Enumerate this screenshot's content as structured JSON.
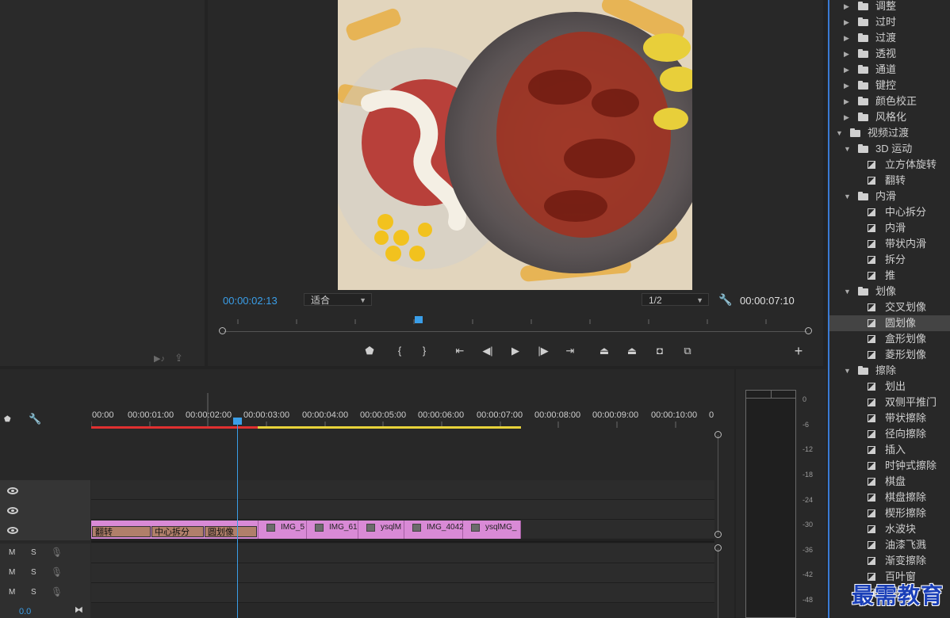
{
  "program": {
    "current_timecode": "00:00:02:13",
    "fit_label": "适合",
    "resolution_label": "1/2",
    "duration_timecode": "00:00:07:10"
  },
  "timeline": {
    "ruler": [
      "00:00",
      "00:00:01:00",
      "00:00:02:00",
      "00:00:03:00",
      "00:00:04:00",
      "00:00:05:00",
      "00:00:06:00",
      "00:00:07:00",
      "00:00:08:00",
      "00:00:09:00",
      "00:00:10:00",
      "0"
    ],
    "transitions": [
      "翻转",
      "中心拆分",
      "圆划像"
    ],
    "clips": [
      "IMG_5",
      "IMG_61",
      "ysqlM",
      "IMG_4042",
      "ysqlMG_"
    ],
    "audio_tracks": [
      {
        "m": "M",
        "s": "S"
      },
      {
        "m": "M",
        "s": "S"
      },
      {
        "m": "M",
        "s": "S"
      }
    ],
    "master_value": "0.0"
  },
  "meter": {
    "labels": [
      "0",
      "-6",
      "-12",
      "-18",
      "-24",
      "-30",
      "-36",
      "-42",
      "-48"
    ]
  },
  "effects": {
    "rows": [
      {
        "label": "调整",
        "type": "folder",
        "level": 1,
        "expanded": false
      },
      {
        "label": "过时",
        "type": "folder",
        "level": 1,
        "expanded": false
      },
      {
        "label": "过渡",
        "type": "folder",
        "level": 1,
        "expanded": false
      },
      {
        "label": "透视",
        "type": "folder",
        "level": 1,
        "expanded": false
      },
      {
        "label": "通道",
        "type": "folder",
        "level": 1,
        "expanded": false
      },
      {
        "label": "键控",
        "type": "folder",
        "level": 1,
        "expanded": false
      },
      {
        "label": "颜色校正",
        "type": "folder",
        "level": 1,
        "expanded": false
      },
      {
        "label": "风格化",
        "type": "folder",
        "level": 1,
        "expanded": false
      },
      {
        "label": "视频过渡",
        "type": "folder",
        "level": 0,
        "expanded": true
      },
      {
        "label": "3D 运动",
        "type": "folder",
        "level": 1,
        "expanded": true
      },
      {
        "label": "立方体旋转",
        "type": "fx",
        "level": 2
      },
      {
        "label": "翻转",
        "type": "fx",
        "level": 2
      },
      {
        "label": "内滑",
        "type": "folder",
        "level": 1,
        "expanded": true
      },
      {
        "label": "中心拆分",
        "type": "fx",
        "level": 2
      },
      {
        "label": "内滑",
        "type": "fx",
        "level": 2
      },
      {
        "label": "带状内滑",
        "type": "fx",
        "level": 2
      },
      {
        "label": "拆分",
        "type": "fx",
        "level": 2
      },
      {
        "label": "推",
        "type": "fx",
        "level": 2
      },
      {
        "label": "划像",
        "type": "folder",
        "level": 1,
        "expanded": true
      },
      {
        "label": "交叉划像",
        "type": "fx",
        "level": 2
      },
      {
        "label": "圆划像",
        "type": "fx",
        "level": 2,
        "selected": true
      },
      {
        "label": "盒形划像",
        "type": "fx",
        "level": 2
      },
      {
        "label": "菱形划像",
        "type": "fx",
        "level": 2
      },
      {
        "label": "擦除",
        "type": "folder",
        "level": 1,
        "expanded": true
      },
      {
        "label": "划出",
        "type": "fx",
        "level": 2
      },
      {
        "label": "双侧平推门",
        "type": "fx",
        "level": 2
      },
      {
        "label": "带状擦除",
        "type": "fx",
        "level": 2
      },
      {
        "label": "径向擦除",
        "type": "fx",
        "level": 2
      },
      {
        "label": "插入",
        "type": "fx",
        "level": 2
      },
      {
        "label": "时钟式擦除",
        "type": "fx",
        "level": 2
      },
      {
        "label": "棋盘",
        "type": "fx",
        "level": 2
      },
      {
        "label": "棋盘擦除",
        "type": "fx",
        "level": 2
      },
      {
        "label": "楔形擦除",
        "type": "fx",
        "level": 2
      },
      {
        "label": "水波块",
        "type": "fx",
        "level": 2
      },
      {
        "label": "油漆飞溅",
        "type": "fx",
        "level": 2
      },
      {
        "label": "渐变擦除",
        "type": "fx",
        "level": 2
      },
      {
        "label": "百叶窗",
        "type": "fx",
        "level": 2
      },
      {
        "label": "随机块",
        "type": "fx",
        "level": 2
      }
    ]
  },
  "watermark": "最需教育",
  "colors": {
    "accent": "#3a9ee8",
    "clip": "#d98ad6",
    "transition": "#b07f6a",
    "work_area_red": "#e03030",
    "work_area_yellow": "#e8d23a"
  }
}
